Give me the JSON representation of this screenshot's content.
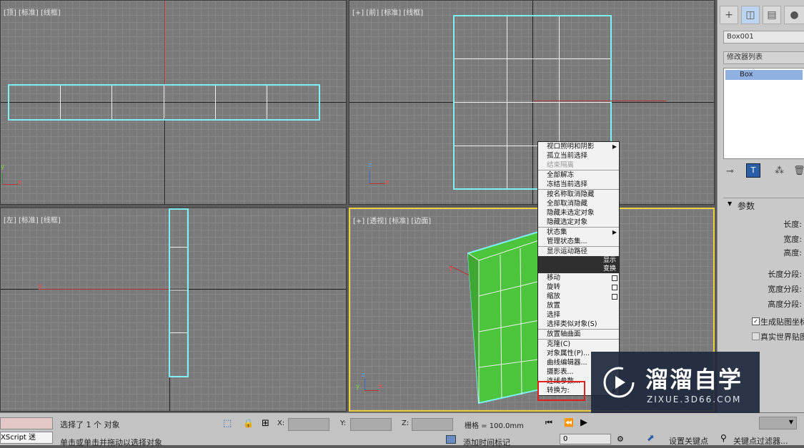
{
  "viewports": {
    "top": {
      "label": "[顶] [标准] [线框]"
    },
    "front": {
      "label": "[+] [前] [标准] [线框]"
    },
    "left": {
      "label": "[左] [标准] [线框]"
    },
    "perspective": {
      "label": "[+] [透视] [标准] [边面]"
    }
  },
  "axis_labels": {
    "x": "x",
    "y": "y",
    "z": "z"
  },
  "context_menu": {
    "items": [
      {
        "label": "视口照明和阴影",
        "type": "submenu"
      },
      {
        "label": "孤立当前选择",
        "type": "item"
      },
      {
        "label": "结束隔离",
        "type": "disabled"
      },
      {
        "label": "全部解冻",
        "type": "item",
        "sep": true
      },
      {
        "label": "冻结当前选择",
        "type": "item"
      },
      {
        "label": "按名称取消隐藏",
        "type": "item",
        "sep": true
      },
      {
        "label": "全部取消隐藏",
        "type": "item"
      },
      {
        "label": "隐藏未选定对象",
        "type": "item"
      },
      {
        "label": "隐藏选定对象",
        "type": "item"
      },
      {
        "label": "状态集",
        "type": "submenu",
        "sep": true
      },
      {
        "label": "管理状态集...",
        "type": "item"
      },
      {
        "label": "显示运动路径",
        "type": "item",
        "sep": true
      },
      {
        "label": "显示",
        "type": "header"
      },
      {
        "label": "变换",
        "type": "header"
      },
      {
        "label": "移动",
        "type": "box"
      },
      {
        "label": "旋转",
        "type": "box"
      },
      {
        "label": "缩放",
        "type": "box"
      },
      {
        "label": "放置",
        "type": "item"
      },
      {
        "label": "选择",
        "type": "item"
      },
      {
        "label": "选择类似对象(S)",
        "type": "item"
      },
      {
        "label": "放置轴曲面",
        "type": "item",
        "sep": true
      },
      {
        "label": "克隆(C)",
        "type": "item",
        "sep": true
      },
      {
        "label": "对象属性(P)...",
        "type": "item"
      },
      {
        "label": "曲线编辑器...",
        "type": "item"
      },
      {
        "label": "摄影表...",
        "type": "item"
      },
      {
        "label": "连线参数...",
        "type": "item"
      },
      {
        "label": "转换为:",
        "type": "submenu",
        "highlight": true
      }
    ]
  },
  "panel": {
    "tabs": [
      "create-tab",
      "modify-tab",
      "hierarchy-tab",
      "motion-tab"
    ],
    "object_name": "Box001",
    "modifier_list": "修改器列表",
    "stack_item": "Box",
    "params_title": "参数",
    "params": [
      "长度:",
      "宽度:",
      "高度:",
      "长度分段:",
      "宽度分段:",
      "高度分段:"
    ],
    "gen_map": "生成贴图坐标",
    "real_world": "真实世界贴图大小",
    "gen_map_checked": true,
    "real_world_checked": false
  },
  "status": {
    "selection": "选择了 1 个 对象",
    "hint": "单击或单击并拖动以选择对象",
    "script": "XScript 迷",
    "x_label": "X:",
    "y_label": "Y:",
    "z_label": "Z:",
    "grid": "栅格 = 100.0mm",
    "add_time_tag": "添加时间标记",
    "frame": "0",
    "set_key": "设置关键点",
    "key_filters": "关键点过滤器..."
  },
  "watermark": {
    "title": "溜溜自学",
    "url": "ZIXUE.3D66.COM"
  },
  "colors": {
    "selection_cyan": "#7ef0f6",
    "box_green": "#4cc43c",
    "active_border": "#f0d040",
    "menu_highlight": "#e02020"
  }
}
